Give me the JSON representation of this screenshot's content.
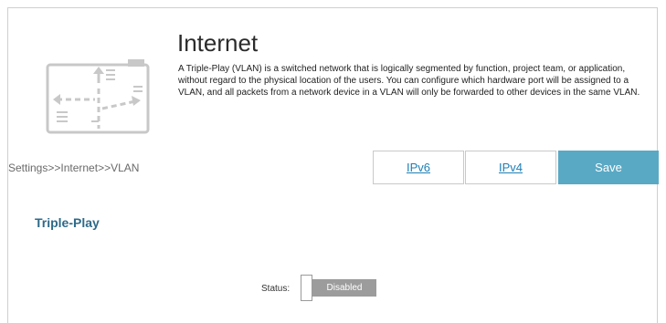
{
  "header": {
    "title": "Internet",
    "description": "A Triple-Play (VLAN) is a switched network that is logically segmented by function, project team, or application, without regard to the physical location of the users. You can configure which hardware port will be assigned to a VLAN, and all packets from a network device in a VLAN will only be forwarded to other devices in the same VLAN.",
    "icon": "network-vlan-icon"
  },
  "nav": {
    "breadcrumb": "Settings>>Internet>>VLAN",
    "tabs": [
      {
        "label": "IPv6"
      },
      {
        "label": "IPv4"
      }
    ],
    "save_label": "Save"
  },
  "section": {
    "title": "Triple-Play",
    "status_label": "Status:",
    "status_value": "Disabled"
  },
  "colors": {
    "accent": "#5aa9c4",
    "link": "#1f7fb6",
    "section_title": "#2e6a89",
    "toggle_off": "#9c9c9c"
  }
}
